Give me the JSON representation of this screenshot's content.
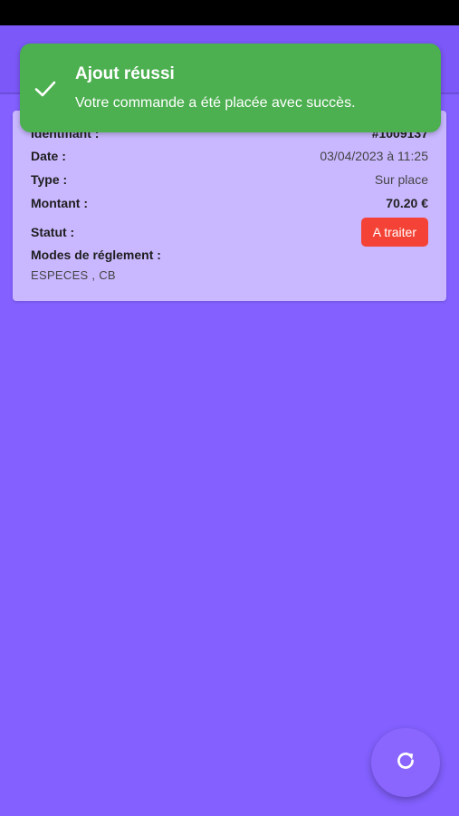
{
  "toast": {
    "title": "Ajout réussi",
    "message": "Votre commande a été placée avec succès.",
    "icon": "check-icon",
    "color": "#4caf50"
  },
  "order": {
    "identifier_label": "Identifiant :",
    "identifier_value": "#1009137",
    "date_label": "Date :",
    "date_value": "03/04/2023 à 11:25",
    "type_label": "Type :",
    "type_value": "Sur place",
    "amount_label": "Montant :",
    "amount_value": "70.20 €",
    "status_label": "Statut :",
    "status_value": "A traiter",
    "status_color": "#f44336",
    "payment_modes_label": "Modes de réglement :",
    "payment_modes_value": "ESPECES , CB"
  },
  "fab": {
    "icon": "refresh-icon"
  },
  "colors": {
    "background": "#8360ff",
    "card": "#c9b8ff",
    "app_bar": "#7b58f7"
  }
}
